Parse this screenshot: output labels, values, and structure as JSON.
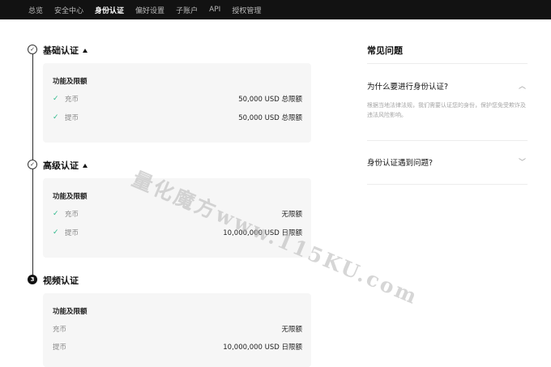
{
  "nav": {
    "items": [
      {
        "label": "总览",
        "active": false
      },
      {
        "label": "安全中心",
        "active": false
      },
      {
        "label": "身份认证",
        "active": true
      },
      {
        "label": "偏好设置",
        "active": false
      },
      {
        "label": "子账户",
        "active": false
      },
      {
        "label": "API",
        "active": false
      },
      {
        "label": "授权管理",
        "active": false
      }
    ]
  },
  "sections": [
    {
      "title": "基础认证",
      "status_icon": "check-icon",
      "card": {
        "heading": "功能及限额",
        "rows": [
          {
            "label": "充币",
            "value": "50,000 USD 总限额",
            "checked": true
          },
          {
            "label": "提币",
            "value": "50,000 USD 总限额",
            "checked": true
          }
        ]
      }
    },
    {
      "title": "高级认证",
      "status_icon": "check-icon",
      "card": {
        "heading": "功能及限额",
        "rows": [
          {
            "label": "充币",
            "value": "无限额",
            "checked": true
          },
          {
            "label": "提币",
            "value": "10,000,000 USD 日限额",
            "checked": true
          }
        ]
      }
    },
    {
      "title": "视频认证",
      "step_number": "3",
      "card": {
        "heading": "功能及限额",
        "rows": [
          {
            "label": "充币",
            "value": "无限额",
            "checked": false
          },
          {
            "label": "提币",
            "value": "10,000,000 USD 日限额",
            "checked": false
          }
        ]
      }
    }
  ],
  "faq": {
    "title": "常见问题",
    "items": [
      {
        "question": "为什么要进行身份认证?",
        "expanded": true,
        "answer": "根据当地法律法规，我们需要认证您的身份，保护您免受欺诈及违法风险影响。"
      },
      {
        "question": "身份认证遇到问题?",
        "expanded": false
      }
    ]
  },
  "watermark": "量化魔方www.115KU.com",
  "colors": {
    "nav_bg": "#121212",
    "check_green": "#2cb98a",
    "card_bg": "#f6f6f6"
  }
}
